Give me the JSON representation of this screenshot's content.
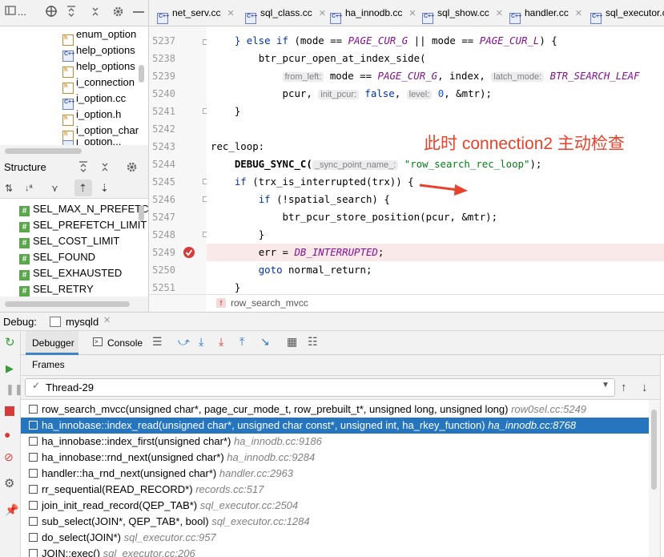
{
  "project": {
    "toolbar_label": "...",
    "files": [
      {
        "name": "enum_option",
        "type": "h"
      },
      {
        "name": "help_options",
        "type": "c"
      },
      {
        "name": "help_options",
        "type": "h"
      },
      {
        "name": "i_connection",
        "type": "h"
      },
      {
        "name": "i_option.cc",
        "type": "c"
      },
      {
        "name": "i_option.h",
        "type": "h"
      },
      {
        "name": "i_option_char",
        "type": "h"
      },
      {
        "name": "i_option...",
        "type": "c"
      }
    ]
  },
  "structure": {
    "title": "Structure",
    "items": [
      "SEL_MAX_N_PREFETCH",
      "SEL_PREFETCH_LIMIT",
      "SEL_COST_LIMIT",
      "SEL_FOUND",
      "SEL_EXHAUSTED",
      "SEL_RETRY"
    ]
  },
  "editor": {
    "tabs": [
      "net_serv.cc",
      "sql_class.cc",
      "ha_innodb.cc",
      "sql_show.cc",
      "handler.cc",
      "sql_executor.cc"
    ],
    "line_numbers": [
      "5237",
      "5238",
      "5239",
      "5240",
      "5241",
      "5242",
      "5243",
      "5244",
      "5245",
      "5246",
      "5247",
      "5248",
      "5249",
      "5250",
      "5251"
    ],
    "breadcrumb_icon": "f",
    "breadcrumb": "row_search_mvcc",
    "code": {
      "l5237_kw1": "} else if",
      "l5237_a": " (mode == ",
      "l5237_c1": "PAGE_CUR_G",
      "l5237_b": " || mode == ",
      "l5237_c2": "PAGE_CUR_L",
      "l5237_e": ") {",
      "l5238": "btr_pcur_open_at_index_side(",
      "l5239_h1": "from_left:",
      "l5239_a": " mode == ",
      "l5239_c": "PAGE_CUR_G",
      "l5239_b": ", index, ",
      "l5239_h2": "latch_mode:",
      "l5239_c2": " BTR_SEARCH_LEAF",
      "l5240_a": "pcur, ",
      "l5240_h1": "init_pcur:",
      "l5240_kw": " false",
      "l5240_b": ", ",
      "l5240_h2": "level:",
      "l5240_n": " 0",
      "l5240_e": ", &mtr);",
      "l5241": "}",
      "l5243": "rec_loop:",
      "l5244_f": "DEBUG_SYNC_C(",
      "l5244_h": "_sync_point_name_:",
      "l5244_s": " \"row_search_rec_loop\"",
      "l5244_e": ");",
      "l5245_kw": "if",
      "l5245_a": " (trx_is_interrupted(trx)) {",
      "l5246_kw": "if",
      "l5246_a": " (!spatial_search) {",
      "l5247": "btr_pcur_store_position(pcur, &mtr);",
      "l5248": "}",
      "l5249_a": "err = ",
      "l5249_c": "DB_INTERRUPTED",
      "l5249_e": ";",
      "l5250_kw": "goto",
      "l5250_a": " normal_return;",
      "l5251": "}"
    },
    "annotation": "此时 connection2 主动检查",
    "annotation_color": "#e8412c"
  },
  "debug": {
    "label": "Debug:",
    "session": "mysqld",
    "tabs": {
      "debugger": "Debugger",
      "console": "Console"
    },
    "frames_label": "Frames",
    "thread": "Thread-29",
    "frames": [
      {
        "fn": "row_search_mvcc(unsigned char*, page_cur_mode_t, row_prebuilt_t*, unsigned long, unsigned long)",
        "loc": "row0sel.cc:5249",
        "selected": false
      },
      {
        "fn": "ha_innobase::index_read(unsigned char*, unsigned char const*, unsigned int, ha_rkey_function)",
        "loc": "ha_innodb.cc:8768",
        "selected": true
      },
      {
        "fn": "ha_innobase::index_first(unsigned char*)",
        "loc": "ha_innodb.cc:9186",
        "selected": false
      },
      {
        "fn": "ha_innobase::rnd_next(unsigned char*)",
        "loc": "ha_innodb.cc:9284",
        "selected": false
      },
      {
        "fn": "handler::ha_rnd_next(unsigned char*)",
        "loc": "handler.cc:2963",
        "selected": false
      },
      {
        "fn": "rr_sequential(READ_RECORD*)",
        "loc": "records.cc:517",
        "selected": false
      },
      {
        "fn": "join_init_read_record(QEP_TAB*)",
        "loc": "sql_executor.cc:2504",
        "selected": false
      },
      {
        "fn": "sub_select(JOIN*, QEP_TAB*, bool)",
        "loc": "sql_executor.cc:1284",
        "selected": false
      },
      {
        "fn": "do_select(JOIN*)",
        "loc": "sql_executor.cc:957",
        "selected": false
      },
      {
        "fn": "JOIN::exec()",
        "loc": "sql_executor.cc:206",
        "selected": false
      }
    ]
  }
}
